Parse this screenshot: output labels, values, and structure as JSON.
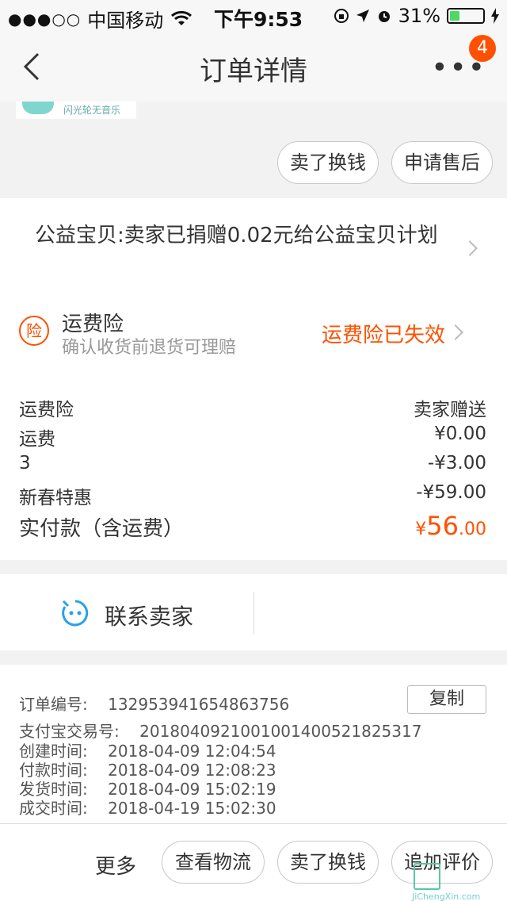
{
  "status_bar": {
    "signal": "●●●○○",
    "carrier": "中国移动",
    "time": "下午9:53",
    "battery": "31%",
    "battery_level": 0.31
  },
  "nav": {
    "title": "订单详情",
    "badge": "4"
  },
  "product": {
    "thumb_text": "闪光轮无音乐"
  },
  "actions_top": {
    "sell_exchange": "卖了换钱",
    "after_sale": "申请售后"
  },
  "charity": {
    "text": "公益宝贝:卖家已捐赠0.02元给公益宝贝计划"
  },
  "insurance": {
    "icon_char": "险",
    "title": "运费险",
    "subtitle": "确认收货前退货可理赔",
    "status": "运费险已失效"
  },
  "fees": [
    {
      "label": "运费险",
      "value": "卖家赠送"
    },
    {
      "label": "运费",
      "value": "¥0.00"
    },
    {
      "label": "3",
      "value": "-¥3.00"
    },
    {
      "label": "新春特惠",
      "value": "-¥59.00"
    }
  ],
  "total": {
    "label": "实付款（含运费）",
    "currency": "¥",
    "integer": "56",
    "decimal": ".00"
  },
  "contact": {
    "label": "联系卖家"
  },
  "order_info": {
    "order_no": "订单编号:    132953941654863756",
    "copy": "复制",
    "alipay_no": "支付宝交易号:    2018040921001001400521825317",
    "created": "创建时间:    2018-04-09 12:04:54",
    "paid": "付款时间:    2018-04-09 12:08:23",
    "shipped": "发货时间:    2018-04-09 15:02:19",
    "completed": "成交时间:    2018-04-19 15:02:30"
  },
  "bottom": {
    "more": "更多",
    "logistics": "查看物流",
    "sell_exchange": "卖了换钱",
    "review": "追加评价"
  },
  "watermark": {
    "text": "JiChengXin.com"
  },
  "colors": {
    "accent": "#ff5000",
    "icon_blue": "#2aa0e8"
  }
}
